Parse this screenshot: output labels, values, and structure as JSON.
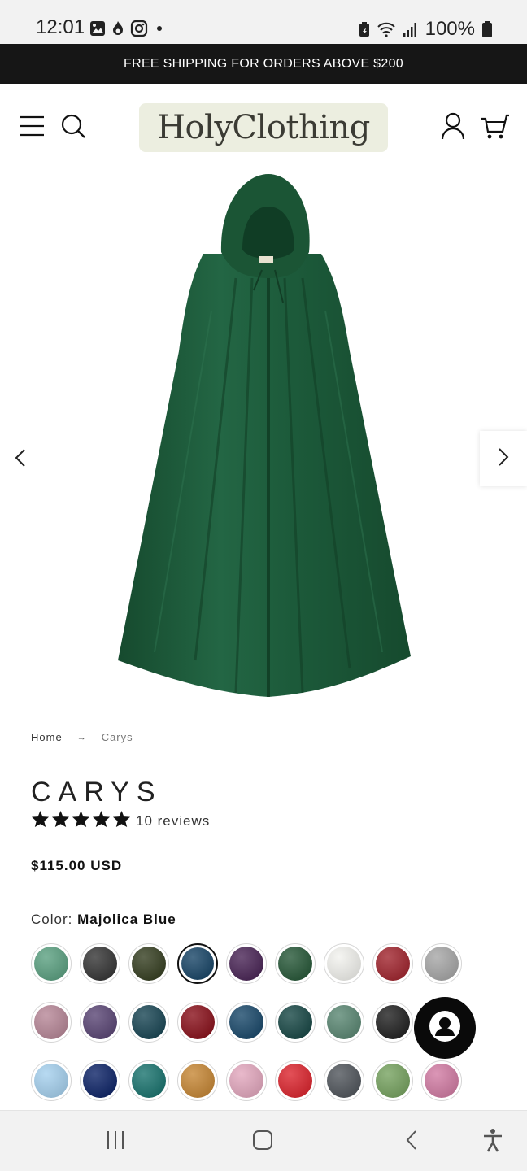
{
  "status_bar": {
    "time": "12:01",
    "battery": "100%",
    "left_icons": [
      "gallery-icon",
      "fire-icon",
      "instagram-icon",
      "dot-icon"
    ],
    "right_icons": [
      "battery-saver-icon",
      "wifi-icon",
      "signal-icon",
      "battery-icon"
    ]
  },
  "announcement": {
    "text": "FREE SHIPPING FOR ORDERS ABOVE $200"
  },
  "header": {
    "logo_text": "HolyClothing",
    "icons": [
      "menu-icon",
      "search-icon",
      "account-icon",
      "cart-icon"
    ]
  },
  "gallery": {
    "image_subject": "green hooded cloak",
    "colors": {
      "cloak": "#1f5a3a",
      "cloak_shadow": "#164a2e",
      "cloak_light": "#2a6b48"
    }
  },
  "breadcrumb": {
    "home": "Home",
    "separator": "→",
    "current": "Carys"
  },
  "product": {
    "title": "CARYS",
    "rating": 5,
    "reviews_text": "10 reviews",
    "price": "$115.00 USD",
    "color_label": "Color:",
    "color_value": "Majolica Blue"
  },
  "swatch_rows": [
    [
      "#5fa384",
      "#3a3a3a",
      "#3a4326",
      "#1e4a6b",
      "#4e2a5a",
      "#2c5c3d",
      "#f3f3ef",
      "#a32a33",
      "#a9a9a9"
    ],
    [
      "#b98a9a",
      "#5e4a78",
      "#1e4a58",
      "#8c1620",
      "#1f4d6e",
      "#1d4c4a",
      "#5e8a76",
      "#262626"
    ],
    [
      "#a8d2ef",
      "#13296b",
      "#1f7772",
      "#c88a3a",
      "#e4aac0",
      "#dd2a33",
      "#555a60",
      "#7aa564",
      "#d37fa6"
    ]
  ],
  "selected_swatch": {
    "row": 0,
    "index": 3
  },
  "chat": {
    "icon": "chat-avatar-icon"
  },
  "navbar": {
    "icons": [
      "recents-icon",
      "home-icon",
      "back-icon",
      "accessibility-icon"
    ]
  }
}
